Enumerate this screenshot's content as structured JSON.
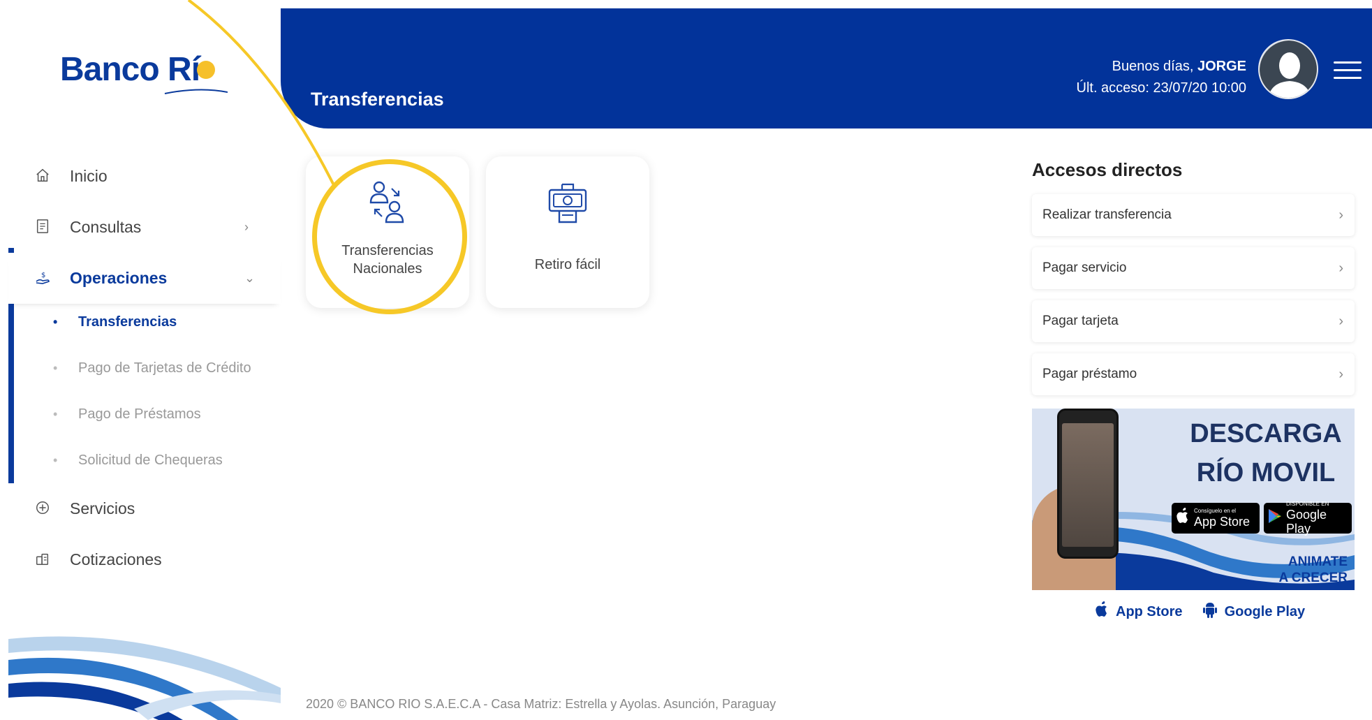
{
  "brand": {
    "name": "Banco Rí",
    "colors": {
      "primary": "#02339a",
      "accent": "#f6c827"
    }
  },
  "header": {
    "title": "Transferencias",
    "greeting_prefix": "Buenos días, ",
    "user_name": "JORGE",
    "last_access": "Últ. acceso: 23/07/20 10:00"
  },
  "sidebar": {
    "items": [
      {
        "label": "Inicio",
        "icon": "home-icon"
      },
      {
        "label": "Consultas",
        "icon": "document-icon"
      },
      {
        "label": "Operaciones",
        "icon": "money-hand-icon"
      }
    ],
    "subitems": [
      {
        "label": "Transferencias"
      },
      {
        "label": "Pago de Tarjetas de Crédito"
      },
      {
        "label": "Pago de Préstamos"
      },
      {
        "label": "Solicitud de Chequeras"
      }
    ],
    "items_after": [
      {
        "label": "Servicios",
        "icon": "plus-circle-icon"
      },
      {
        "label": "Cotizaciones",
        "icon": "coins-icon"
      }
    ]
  },
  "cards": [
    {
      "label_line1": "Transferencias",
      "label_line2": "Nacionales",
      "icon": "transfer-people-icon"
    },
    {
      "label": "Retiro fácil",
      "icon": "cash-withdraw-icon"
    }
  ],
  "accesos": {
    "title": "Accesos directos",
    "items": [
      {
        "label": "Realizar transferencia"
      },
      {
        "label": "Pagar servicio"
      },
      {
        "label": "Pagar tarjeta"
      },
      {
        "label": "Pagar préstamo"
      }
    ]
  },
  "banner": {
    "line1": "DESCARGA",
    "line2": "RÍO MOVIL",
    "appstore_small": "Consíguelo en el",
    "appstore_big": "App Store",
    "googleplay_small": "DISPONIBLE EN",
    "googleplay_big": "Google Play",
    "tag_line1": "ANIMATE",
    "tag_line2": "A CRECER"
  },
  "store_links": {
    "appstore": "App Store",
    "googleplay": "Google Play"
  },
  "footer": {
    "text": "2020  ©  BANCO RIO S.A.E.C.A   - Casa Matriz: Estrella y Ayolas. Asunción, Paraguay"
  }
}
